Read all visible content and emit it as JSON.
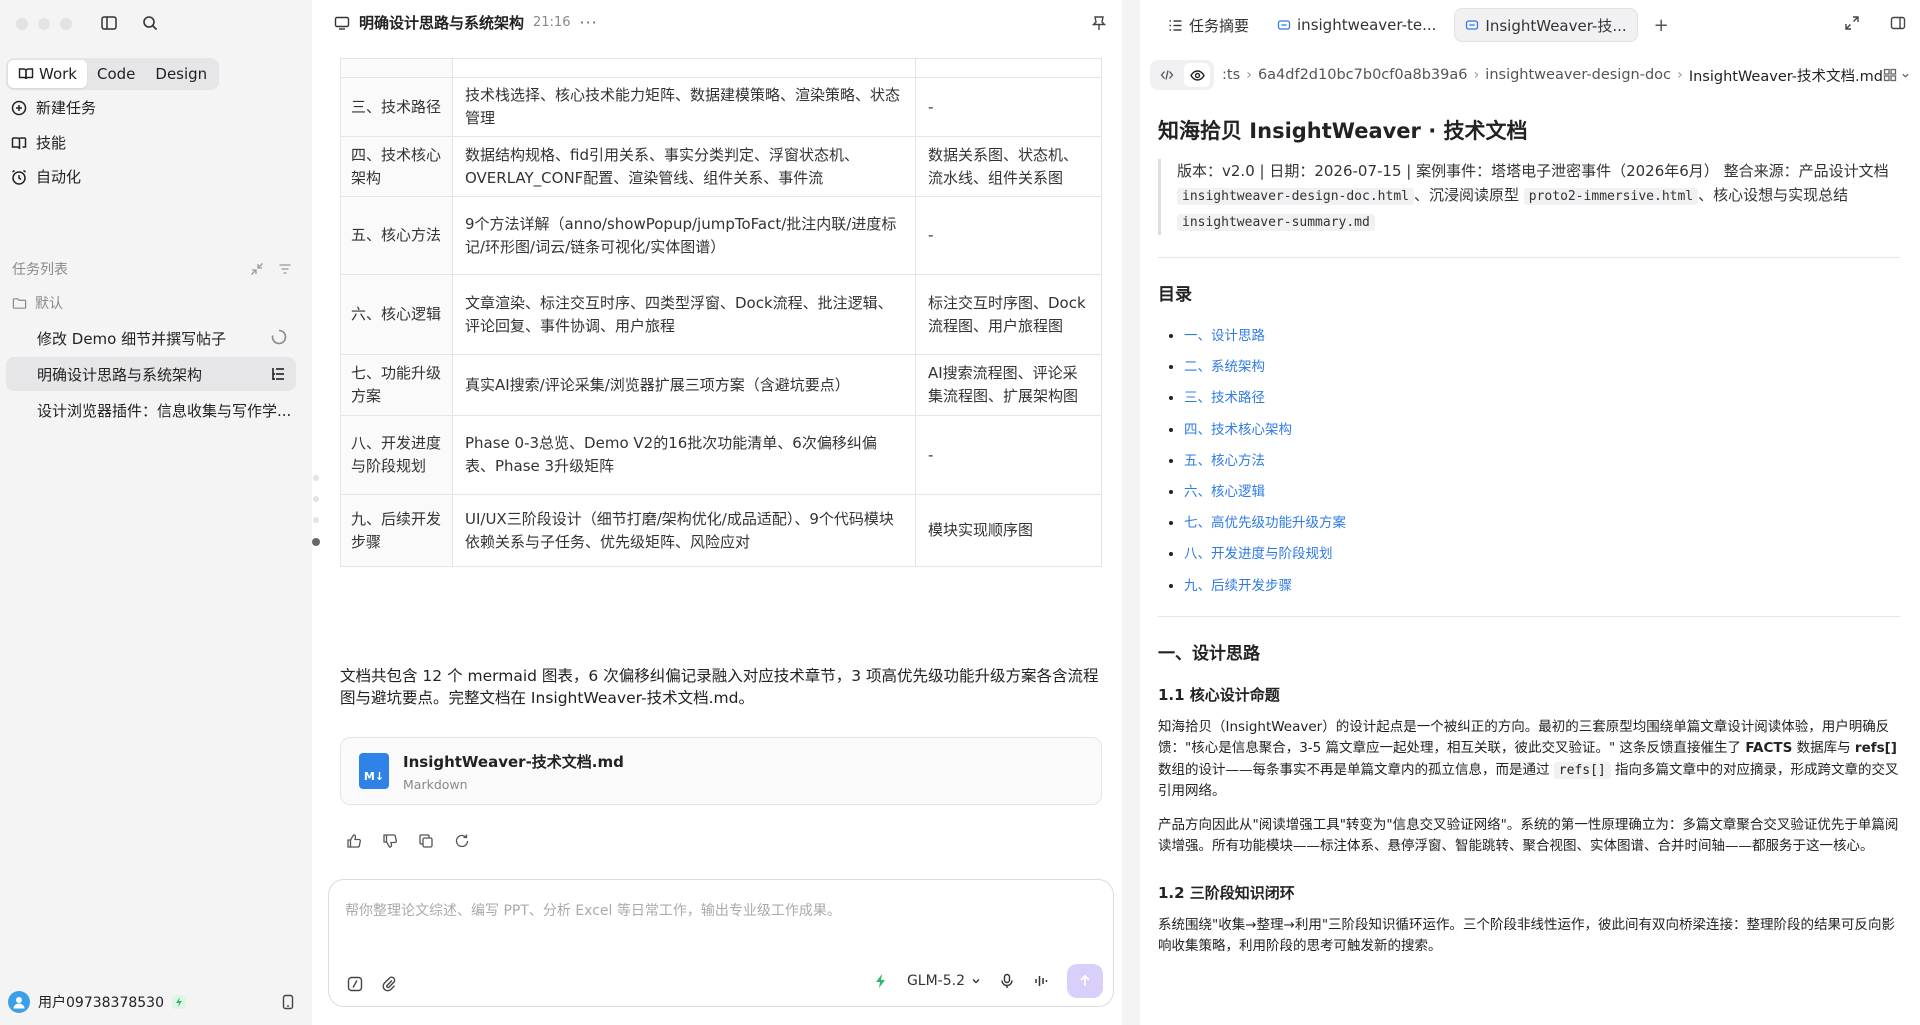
{
  "sidebar": {
    "modes": [
      {
        "label": "Work",
        "icon": "book-open-icon",
        "active": true
      },
      {
        "label": "Code"
      },
      {
        "label": "Design"
      }
    ],
    "nav": [
      {
        "label": "新建任务",
        "icon": "plus-circle-icon"
      },
      {
        "label": "技能",
        "icon": "book-icon"
      },
      {
        "label": "自动化",
        "icon": "alarm-clock-icon"
      }
    ],
    "task_list_title": "任务列表",
    "folder": "默认",
    "tasks": [
      {
        "label": "修改 Demo 细节并撰写帖子",
        "status": "loading"
      },
      {
        "label": "明确设计思路与系统架构",
        "active": true
      },
      {
        "label": "设计浏览器插件：信息收集与写作学..."
      }
    ],
    "user": "用户09738378530"
  },
  "chat": {
    "title": "明确设计思路与系统架构",
    "time": "21:16",
    "table": [
      [
        "三、技术路径",
        "技术栈选择、核心技术能力矩阵、数据建模策略、渲染策略、状态管理",
        "-"
      ],
      [
        "四、技术核心架构",
        "数据结构规格、fid引用关系、事实分类判定、浮窗状态机、OVERLAY_CONF配置、渲染管线、组件关系、事件流",
        "数据关系图、状态机、流水线、组件关系图"
      ],
      [
        "五、核心方法",
        "9个方法详解（anno/showPopup/jumpToFact/批注内联/进度标记/环形图/词云/链条可视化/实体图谱）",
        "-"
      ],
      [
        "六、核心逻辑",
        "文章渲染、标注交互时序、四类型浮窗、Dock流程、批注逻辑、评论回复、事件协调、用户旅程",
        "标注交互时序图、Dock流程图、用户旅程图"
      ],
      [
        "七、功能升级方案",
        "真实AI搜索/评论采集/浏览器扩展三项方案（含避坑要点）",
        "AI搜索流程图、评论采集流程图、扩展架构图"
      ],
      [
        "八、开发进度与阶段规划",
        "Phase 0-3总览、Demo V2的16批次功能清单、6次偏移纠偏表、Phase 3升级矩阵",
        "-"
      ],
      [
        "九、后续开发步骤",
        "UI/UX三阶段设计（细节打磨/架构优化/成品适配）、9个代码模块依赖关系与子任务、优先级矩阵、风险应对",
        "模块实现顺序图"
      ]
    ],
    "summary": "文档共包含 12 个 mermaid 图表，6 次偏移纠偏记录融入对应技术章节，3 项高优先级功能升级方案各含流程图与避坑要点。完整文档在 InsightWeaver-技术文档.md。",
    "file": {
      "name": "InsightWeaver-技术文档.md",
      "type": "Markdown",
      "badge": "M↓"
    },
    "composer": {
      "placeholder": "帮你整理论文综述、编写 PPT、分析 Excel 等日常工作，输出专业级工作成果。",
      "model": "GLM-5.2"
    }
  },
  "panel": {
    "tabs": [
      {
        "label": "任务摘要",
        "icon": "list-icon"
      },
      {
        "label": "insightweaver-te...",
        "icon": "file-icon"
      },
      {
        "label": "InsightWeaver-技...",
        "icon": "file-icon",
        "active": true
      }
    ],
    "breadcrumb": [
      ":ts",
      "6a4df2d10bc7b0cf0a8b39a6",
      "insightweaver-design-doc",
      "InsightWeaver-技术文档.md"
    ],
    "title": "知海拾贝 InsightWeaver · 技术文档",
    "meta": {
      "t1": "版本：v2.0 | 日期：2026-07-15 | 案例事件：塔塔电子泄密事件（2026年6月） 整合来源：产品设计文档 ",
      "c1": "insightweaver-design-doc.html",
      "t2": "、沉浸阅读原型 ",
      "c2": "proto2-immersive.html",
      "t3": "、核心设想与实现总结 ",
      "c3": "insightweaver-summary.md"
    },
    "toc_title": "目录",
    "toc": [
      "一、设计思路",
      "二、系统架构",
      "三、技术路径",
      "四、技术核心架构",
      "五、核心方法",
      "六、核心逻辑",
      "七、高优先级功能升级方案",
      "八、开发进度与阶段规划",
      "九、后续开发步骤"
    ],
    "h1": "一、设计思路",
    "h2a": "1.1 核心设计命题",
    "p1": {
      "a": "知海拾贝（InsightWeaver）的设计起点是一个被纠正的方向。最初的三套原型均围绕单篇文章设计阅读体验，用户明确反馈：\"核心是信息聚合，3-5 篇文章应一起处理，相互关联，彼此交叉验证。\" 这条反馈直接催生了 ",
      "b1": "FACTS",
      "c": " 数据库与 ",
      "b2": "refs[]",
      "d": " 数组的设计——每条事实不再是单篇文章内的孤立信息，而是通过 ",
      "code": "refs[]",
      "e": " 指向多篇文章中的对应摘录，形成跨文章的交叉引用网络。"
    },
    "p2": "产品方向因此从\"阅读增强工具\"转变为\"信息交叉验证网络\"。系统的第一性原理确立为：多篇文章聚合交叉验证优先于单篇阅读增强。所有功能模块——标注体系、悬停浮窗、智能跳转、聚合视图、实体图谱、合并时间轴——都服务于这一核心。",
    "h2b": "1.2 三阶段知识闭环",
    "p3": "系统围绕\"收集→整理→利用\"三阶段知识循环运作。三个阶段非线性运作，彼此间有双向桥梁连接：整理阶段的结果可反向影响收集策略，利用阶段的思考可触发新的搜索。"
  }
}
